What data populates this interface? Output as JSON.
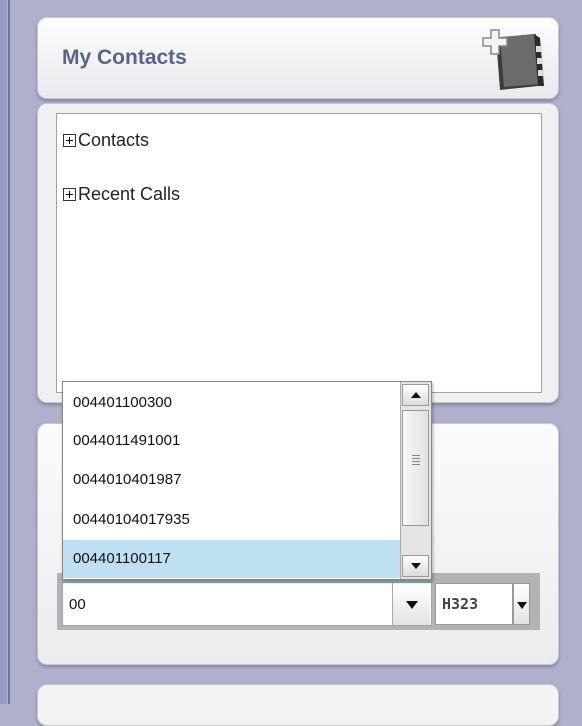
{
  "header": {
    "title": "My Contacts",
    "add_icon": "add-address-book-icon"
  },
  "tree": {
    "items": [
      {
        "label": "Contacts",
        "icon": "expand-plus-icon"
      },
      {
        "label": "Recent Calls",
        "icon": "expand-plus-icon"
      }
    ]
  },
  "autocomplete": {
    "options": [
      "004401100300",
      "0044011491001",
      "0044010401987",
      "00440104017935",
      "004401100117"
    ],
    "selected_index": 4
  },
  "dial": {
    "number_value": "00",
    "protocol": "H323"
  },
  "colors": {
    "background": "#aeb0cc",
    "title": "#5b6489",
    "selection": "#bfe0f3"
  }
}
